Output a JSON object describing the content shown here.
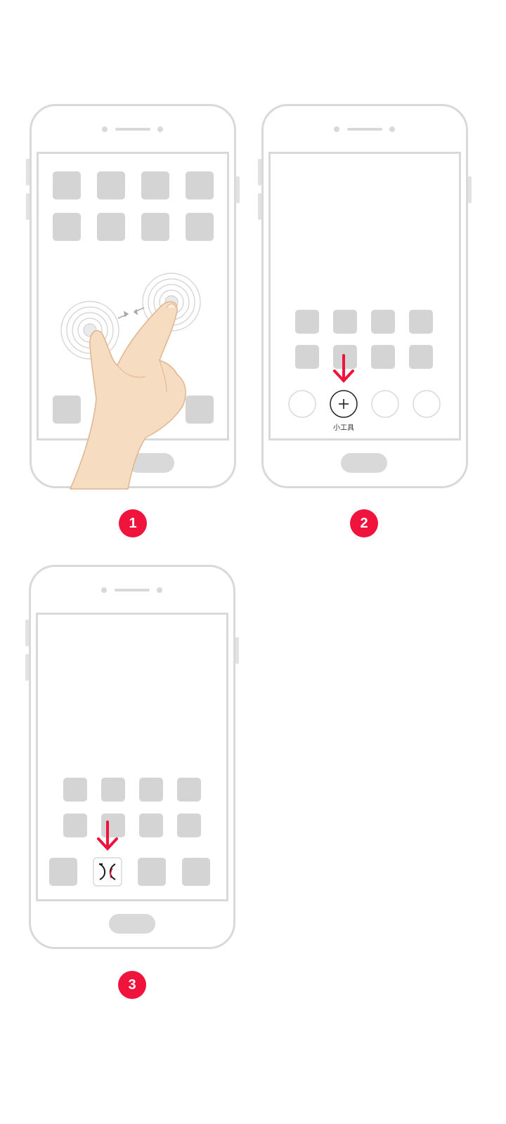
{
  "steps": [
    {
      "number": "1",
      "description": "pinch-gesture-on-home-screen"
    },
    {
      "number": "2",
      "description": "tap-add-widget"
    },
    {
      "number": "3",
      "description": "widget-added"
    }
  ],
  "widget_button": {
    "label": "小工具",
    "icon": "plus-icon"
  },
  "colors": {
    "accent": "#f0143c",
    "phone_outline": "#d9d9d9",
    "app_tile": "#d4d4d4",
    "skin": "#f6dcc0"
  },
  "icons": [
    "pinch-gesture-icon",
    "down-arrow-icon",
    "plus-icon",
    "widget-logo-icon"
  ]
}
